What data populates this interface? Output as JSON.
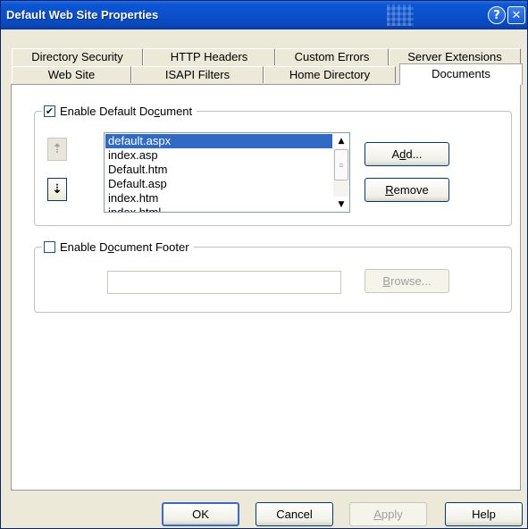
{
  "window": {
    "title": "Default Web Site Properties"
  },
  "titlebar": {
    "help_glyph": "?",
    "close_glyph": "✕"
  },
  "tabs": {
    "row1": [
      {
        "label": "Directory Security"
      },
      {
        "label": "HTTP Headers"
      },
      {
        "label": "Custom Errors"
      },
      {
        "label": "Server Extensions"
      }
    ],
    "row2": [
      {
        "label": "Web Site"
      },
      {
        "label": "ISAPI Filters"
      },
      {
        "label": "Home Directory"
      },
      {
        "label": "Documents",
        "active": true
      }
    ]
  },
  "default_document": {
    "label_pre": "Enable Default Do",
    "label_u": "c",
    "label_post": "ument",
    "checked": true,
    "check_glyph": "✔",
    "move_up_glyph": "⇡",
    "move_down_glyph": "⇣",
    "items": [
      "default.aspx",
      "index.asp",
      "Default.htm",
      "Default.asp",
      "index.htm",
      "index.html"
    ],
    "selected_index": 0,
    "scroll_up_glyph": "▲",
    "scroll_down_glyph": "▼",
    "thumb_glyph": "≡",
    "add_pre": "A",
    "add_u": "d",
    "add_post": "d...",
    "remove_u": "R",
    "remove_post": "emove"
  },
  "document_footer": {
    "label_pre": "Enable D",
    "label_u": "o",
    "label_post": "cument Footer",
    "checked": false,
    "path_value": "",
    "browse_u": "B",
    "browse_post": "rowse..."
  },
  "footer_buttons": {
    "ok": "OK",
    "cancel": "Cancel",
    "apply_u": "A",
    "apply_post": "pply",
    "help": "Help"
  }
}
